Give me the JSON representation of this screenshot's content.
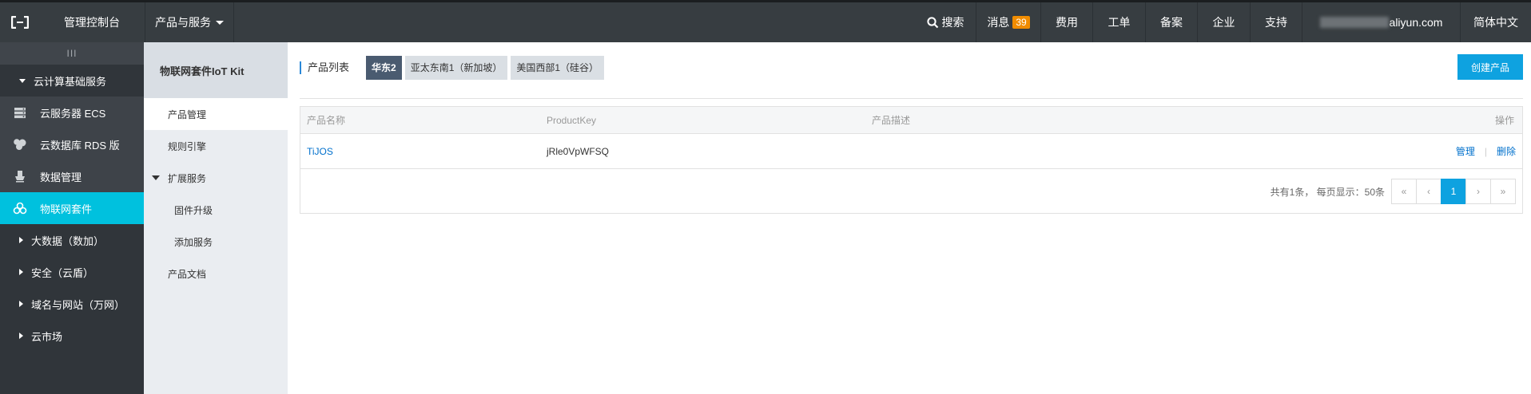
{
  "topbar": {
    "logo_icon": "aliyun-logo-icon",
    "console_title": "管理控制台",
    "products_label": "产品与服务",
    "search_label": "搜索",
    "messages_label": "消息",
    "messages_count": "39",
    "billing_label": "费用",
    "ticket_label": "工单",
    "icp_label": "备案",
    "enterprise_label": "企业",
    "support_label": "支持",
    "account_suffix": "aliyun.com",
    "language_label": "简体中文"
  },
  "sidebar": {
    "toggle_label": "III",
    "group_label": "云计算基础服务",
    "items": [
      {
        "label": "云服务器 ECS",
        "icon": "server-icon"
      },
      {
        "label": "云数据库 RDS 版",
        "icon": "database-icon"
      },
      {
        "label": "数据管理",
        "icon": "data-management-icon"
      },
      {
        "label": "物联网套件",
        "icon": "iot-icon"
      }
    ],
    "groups": [
      {
        "label": "大数据（数加）"
      },
      {
        "label": "安全（云盾）"
      },
      {
        "label": "域名与网站（万网）"
      },
      {
        "label": "云市场"
      }
    ]
  },
  "subnav": {
    "title": "物联网套件IoT Kit",
    "product_mgmt": "产品管理",
    "rules_engine": "规则引擎",
    "extensions": "扩展服务",
    "firmware_upgrade": "固件升级",
    "add_service": "添加服务",
    "product_docs": "产品文档"
  },
  "main": {
    "list_title": "产品列表",
    "regions": [
      "华东2",
      "亚太东南1（新加坡）",
      "美国西部1（硅谷）"
    ],
    "active_region": "华东2",
    "create_button": "创建产品",
    "table": {
      "headers": [
        "产品名称",
        "ProductKey",
        "产品描述",
        "操作"
      ],
      "rows": [
        {
          "name": "TiJOS",
          "product_key": "jRle0VpWFSQ",
          "description": "",
          "manage": "管理",
          "delete": "删除",
          "divider": "|"
        }
      ]
    },
    "pagination": {
      "info": "共有1条， 每页显示：50条",
      "first": "«",
      "prev": "‹",
      "current": "1",
      "next": "›",
      "last": "»"
    }
  },
  "colors": {
    "topbar_bg": "#373d41",
    "sidebar_bg": "#30353a",
    "sidebar_active": "#00c1de",
    "primary_button": "#0ea2e0",
    "region_active": "#4a5b70",
    "badge": "#f08c00",
    "link": "#0070cc"
  }
}
